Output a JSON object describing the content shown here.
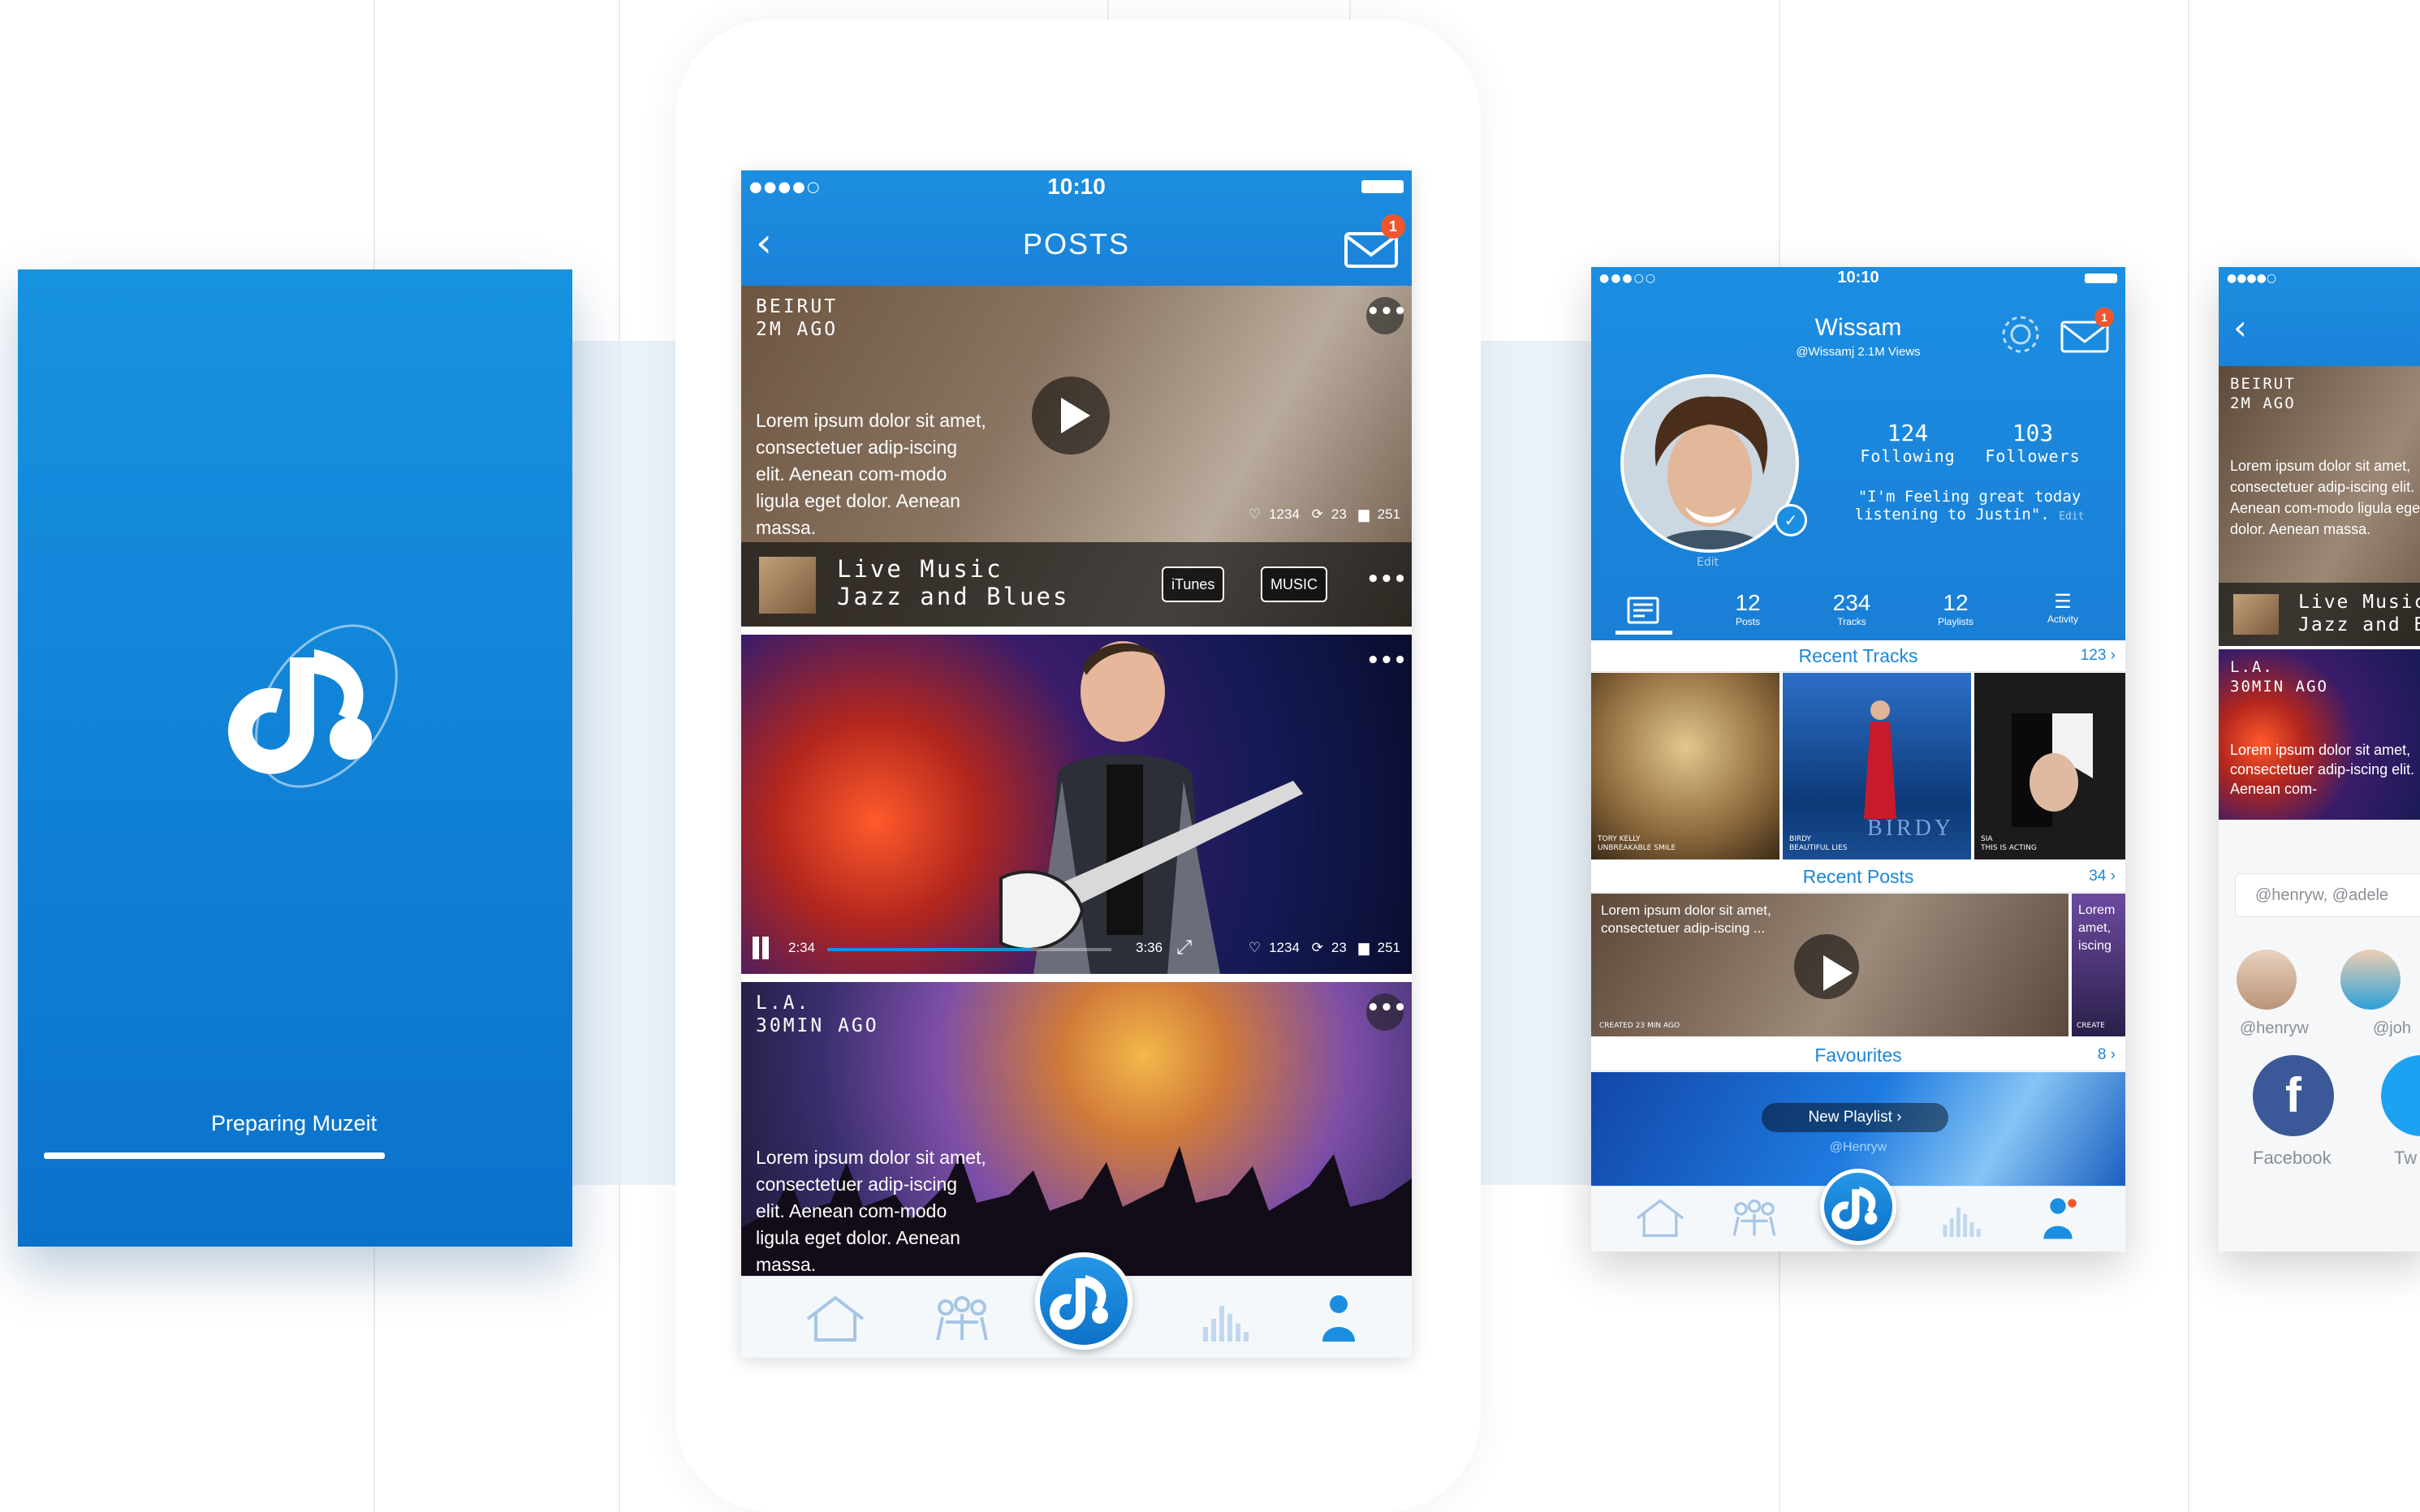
{
  "splash": {
    "status_text": "Preparing Muzeit",
    "progress": 0.8
  },
  "status_bar": {
    "time": "10:10"
  },
  "posts": {
    "title": "POSTS",
    "mail_badge": "1",
    "items": [
      {
        "location": "BEIRUT",
        "ago": "2M AGO",
        "text": "Lorem ipsum dolor sit amet, consectetuer adip-iscing elit. Aenean com-modo ligula eget dolor. Aenean massa.",
        "likes": "1234",
        "reposts": "23",
        "comments": "251",
        "track_line1": "Live Music",
        "track_line2": "Jazz and Blues",
        "store1": "iTunes",
        "store2": "MUSIC"
      },
      {
        "elapsed": "2:34",
        "duration": "3:36",
        "likes": "1234",
        "reposts": "23",
        "comments": "251",
        "progress": 0.72
      },
      {
        "location": "L.A.",
        "ago": "30MIN AGO",
        "text": "Lorem ipsum dolor sit amet, consectetuer adip-iscing elit. Aenean com-modo ligula eget dolor. Aenean massa."
      }
    ]
  },
  "profile": {
    "time": "10:10",
    "name": "Wissam",
    "handle": "@Wissamj",
    "views": "2.1M Views",
    "mail_badge": "1",
    "following_count": "124",
    "following_label": "Following",
    "followers_count": "103",
    "followers_label": "Followers",
    "quote": "\"I'm Feeling great today listening to Justin\".",
    "quote_edit": "Edit",
    "edit_label": "Edit",
    "tabs": [
      {
        "count": "12",
        "label": "Posts"
      },
      {
        "count": "234",
        "label": "Tracks"
      },
      {
        "count": "12",
        "label": "Playlists"
      },
      {
        "label": "Activity"
      }
    ],
    "recent_tracks": {
      "title": "Recent Tracks",
      "count": "123"
    },
    "tracks": [
      {
        "artist": "TORY KELLY",
        "album": "UNBREAKABLE SMILE"
      },
      {
        "artist": "BIRDY",
        "album": "BEAUTIFUL LIES",
        "cover_text": "BIRDY"
      },
      {
        "artist": "SIA",
        "album": "THIS IS ACTING"
      }
    ],
    "recent_posts": {
      "title": "Recent Posts",
      "count": "34"
    },
    "post_preview": "Lorem ipsum dolor sit amet, consectetuer adip-iscing ...",
    "post_created": "CREATED 23 MIN AGO",
    "post_preview2": "Lorem amet, iscing",
    "post_created2": "CREATE",
    "favourites": {
      "title": "Favourites",
      "count": "8"
    },
    "new_playlist": "New Playlist",
    "playlist_owner": "@Henryw"
  },
  "share": {
    "location": "BEIRUT",
    "ago": "2M AGO",
    "text": "Lorem ipsum dolor sit amet, consectetuer adip-iscing elit. Aenean com-modo ligula eget dolor. Aenean massa.",
    "track_line1": "Live Music",
    "track_line2": "Jazz and B",
    "location2": "L.A.",
    "ago2": "30MIN AGO",
    "text2": "Lorem ipsum dolor sit amet, consectetuer adip-iscing elit. Aenean com-",
    "mention_input": "@henryw, @adele",
    "user1": "@henryw",
    "user2": "@joh",
    "social1": "Facebook",
    "social2": "Tw"
  }
}
